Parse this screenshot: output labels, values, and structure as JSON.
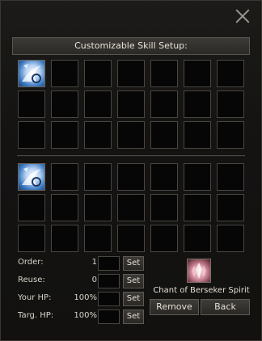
{
  "window": {
    "title": "Customizable Skill Setup:",
    "close_icon": "close-icon"
  },
  "top_grid": {
    "columns": 7,
    "rows": 3,
    "filled_slots": [
      0
    ],
    "skill_icon": "spirit-skill-icon"
  },
  "bottom_grid": {
    "columns": 7,
    "rows": 3,
    "filled_slots": [
      0
    ],
    "skill_icon": "spirit-skill-icon"
  },
  "settings": [
    {
      "label": "Order:",
      "value": "1",
      "set_label": "Set"
    },
    {
      "label": "Reuse:",
      "value": "0",
      "set_label": "Set"
    },
    {
      "label": "Your HP:",
      "value": "100%",
      "set_label": "Set"
    },
    {
      "label": "Targ. HP:",
      "value": "100%",
      "set_label": "Set"
    }
  ],
  "selected_item": {
    "icon": "crystal-item-icon",
    "name": "Chant of Berseker Spirit"
  },
  "buttons": {
    "remove_label": "Remove",
    "back_label": "Back"
  },
  "colors": {
    "background": "#121110",
    "panel_border": "#4a4640",
    "text": "#e4dfd4"
  }
}
